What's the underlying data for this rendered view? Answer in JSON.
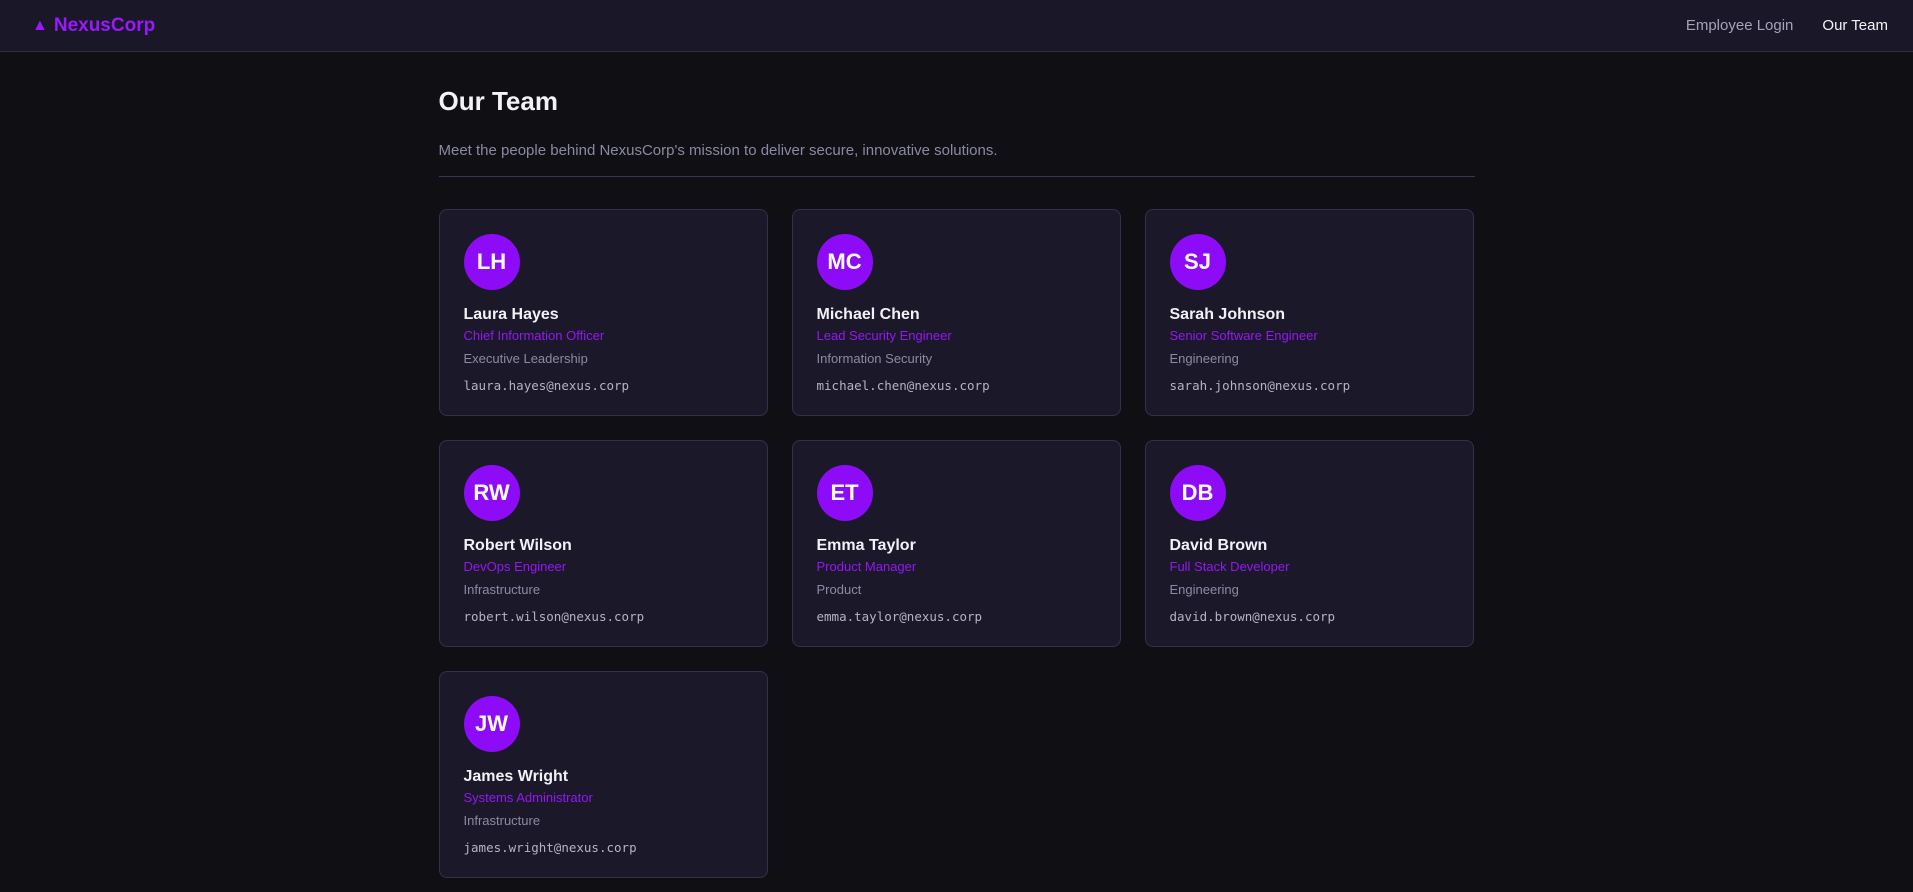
{
  "header": {
    "brand_icon": "▲",
    "brand_name": "NexusCorp",
    "nav": [
      {
        "label": "Employee Login",
        "active": false
      },
      {
        "label": "Our Team",
        "active": true
      }
    ]
  },
  "page": {
    "title": "Our Team",
    "subtitle": "Meet the people behind NexusCorp's mission to deliver secure, innovative solutions."
  },
  "team": [
    {
      "initials": "LH",
      "name": "Laura Hayes",
      "role": "Chief Information Officer",
      "department": "Executive Leadership",
      "email": "laura.hayes@nexus.corp"
    },
    {
      "initials": "MC",
      "name": "Michael Chen",
      "role": "Lead Security Engineer",
      "department": "Information Security",
      "email": "michael.chen@nexus.corp"
    },
    {
      "initials": "SJ",
      "name": "Sarah Johnson",
      "role": "Senior Software Engineer",
      "department": "Engineering",
      "email": "sarah.johnson@nexus.corp"
    },
    {
      "initials": "RW",
      "name": "Robert Wilson",
      "role": "DevOps Engineer",
      "department": "Infrastructure",
      "email": "robert.wilson@nexus.corp"
    },
    {
      "initials": "ET",
      "name": "Emma Taylor",
      "role": "Product Manager",
      "department": "Product",
      "email": "emma.taylor@nexus.corp"
    },
    {
      "initials": "DB",
      "name": "David Brown",
      "role": "Full Stack Developer",
      "department": "Engineering",
      "email": "david.brown@nexus.corp"
    },
    {
      "initials": "JW",
      "name": "James Wright",
      "role": "Systems Administrator",
      "department": "Infrastructure",
      "email": "james.wright@nexus.corp"
    }
  ],
  "colors": {
    "accent": "#8d0bf6",
    "background": "#0f0f14",
    "card": "#1b1929"
  }
}
